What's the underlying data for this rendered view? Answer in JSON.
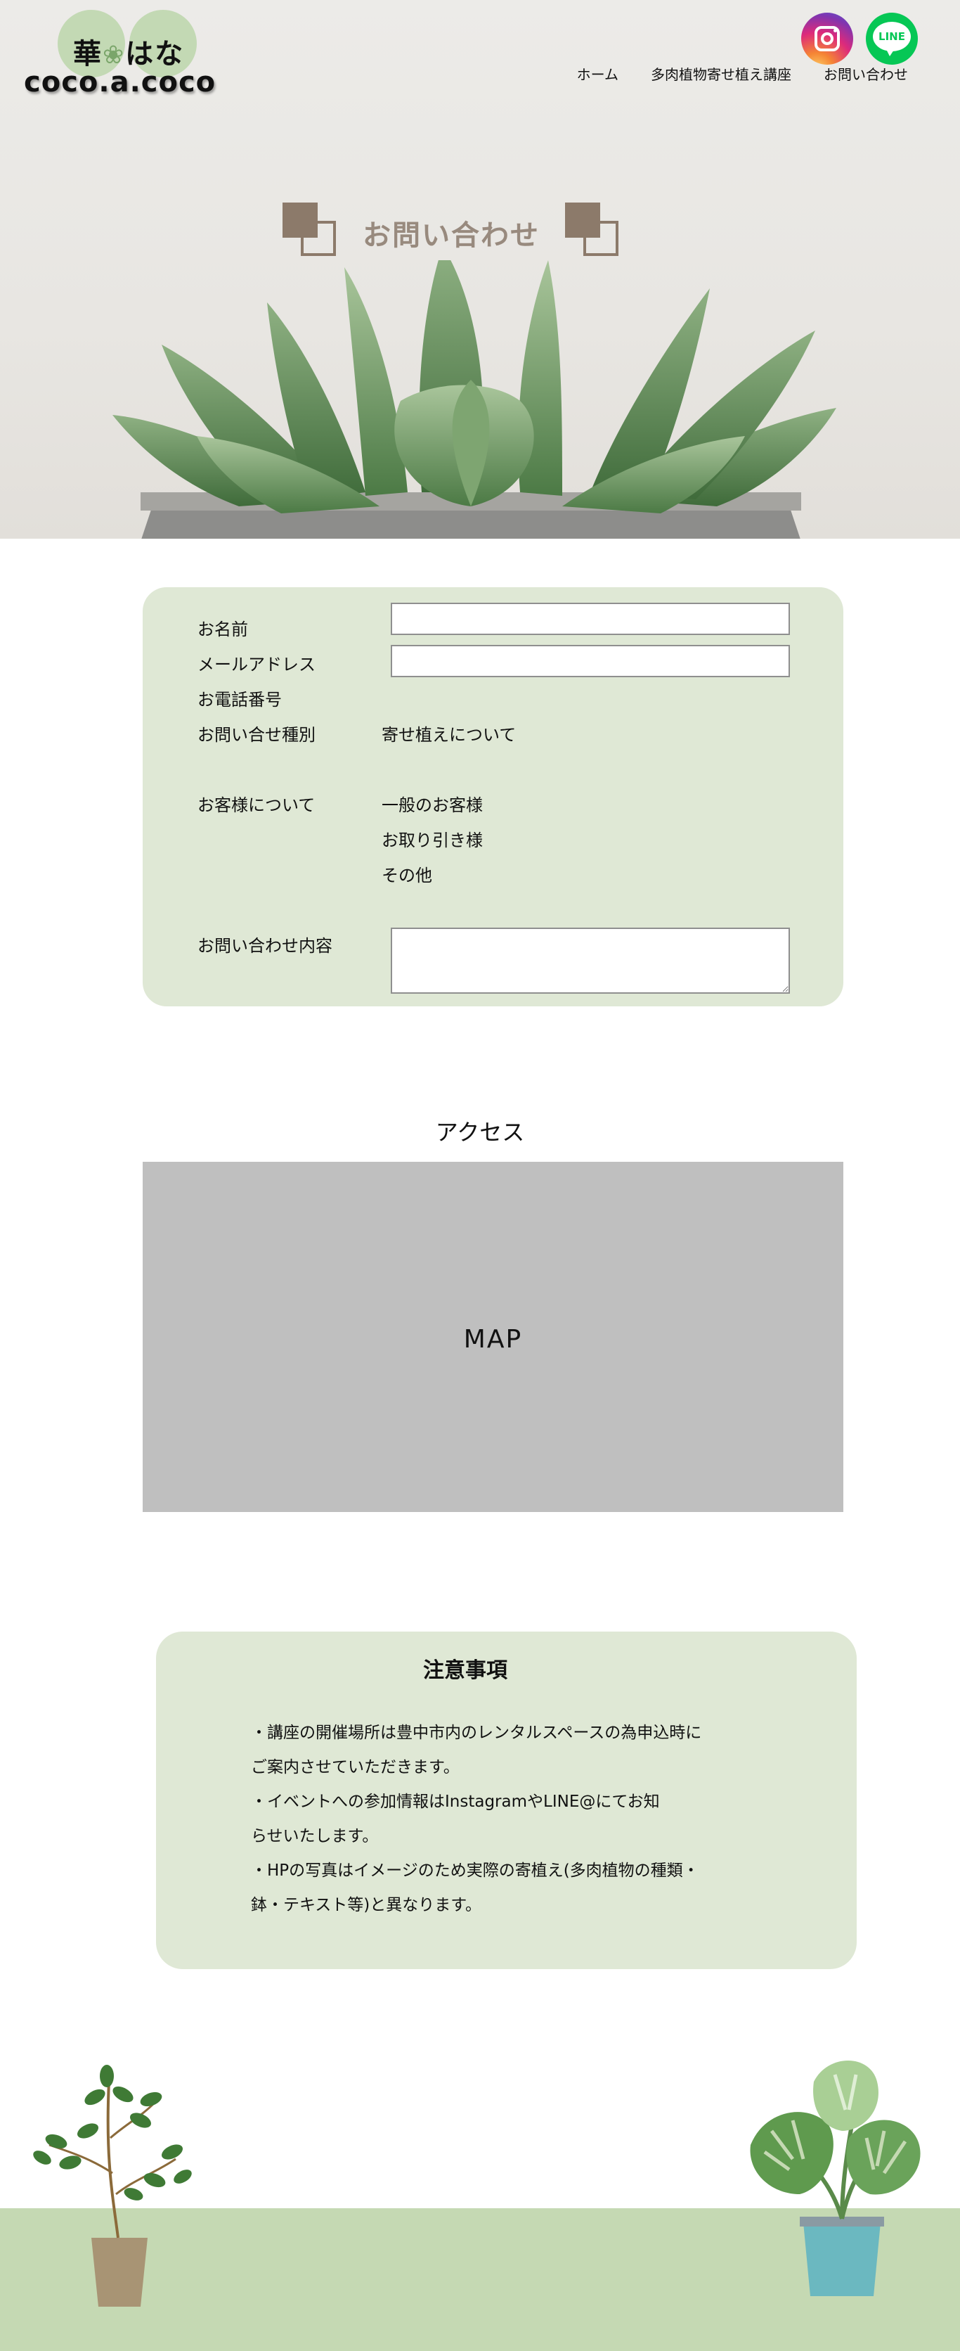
{
  "header": {
    "logo_top": "華",
    "logo_flower": "❀",
    "logo_top_rest": "はな",
    "logo_bottom": "coco.a.coco",
    "nav": [
      {
        "label": "ホーム"
      },
      {
        "label": "多肉植物寄せ植え講座"
      },
      {
        "label": "お問い合わせ"
      }
    ],
    "social": [
      {
        "name": "instagram",
        "icon": "instagram-icon",
        "color": "#dd2a7b"
      },
      {
        "name": "line",
        "icon": "line-icon",
        "label": "LINE",
        "color": "#06c755"
      }
    ]
  },
  "hero": {
    "title": "お問い合わせ"
  },
  "form": {
    "fields": {
      "name": "お名前",
      "email": "メールアドレス",
      "phone": "お電話番号",
      "inquiry_type": "お問い合せ種別",
      "inquiry_type_value": "寄せ植えについて",
      "customer": "お客様について",
      "customer_options": [
        "一般のお客様",
        "お取り引き様",
        "その他"
      ],
      "message": "お問い合わせ内容"
    }
  },
  "access": {
    "title": "アクセス",
    "map_label": "MAP"
  },
  "notes": {
    "title": "注意事項",
    "items": [
      "・講座の開催場所は豊中市内のレンタルスペースの為申込時に",
      "ご案内させていただきます。",
      "・イベントへの参加情報はInstagramやLINE@にてお知",
      "らせいたします。",
      "・HPの写真はイメージのため実際の寄植え(多肉植物の種類・",
      "鉢・テキスト等)と異なります。"
    ]
  },
  "colors": {
    "card_bg": "#dfe8d5",
    "accent_brown": "#8c7a6a",
    "ground_green": "#c5d9b3",
    "map_gray": "#bfbfbf"
  }
}
